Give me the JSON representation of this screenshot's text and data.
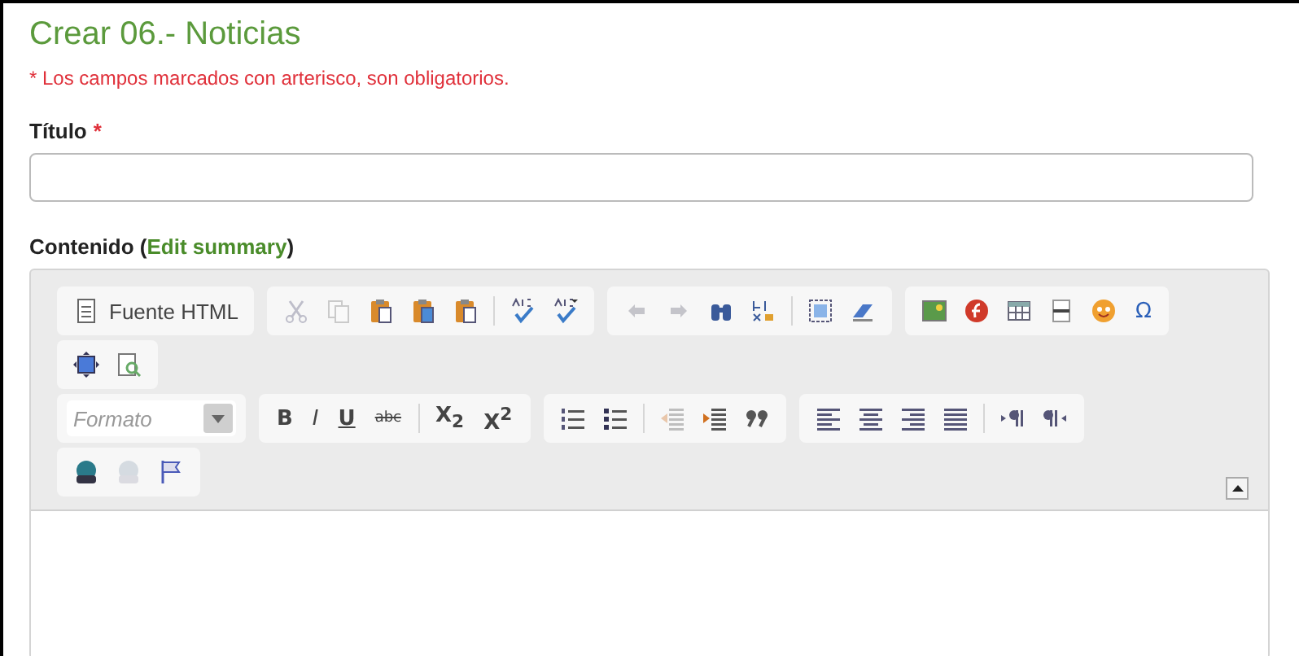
{
  "page": {
    "title": "Crear 06.- Noticias",
    "required_note": "* Los campos marcados con arterisco, son obligatorios."
  },
  "fields": [
    {
      "label": "Título",
      "required_mark": "*"
    }
  ],
  "content": {
    "label_prefix": "Contenido (",
    "link": "Edit summary",
    "label_suffix": ")"
  },
  "editor": {
    "toolbar_rows": [
      [
        [
          {
            "kind": "source",
            "label": "Fuente HTML"
          }
        ],
        [
          {
            "kind": "icon",
            "disabled": true
          },
          {
            "kind": "icon",
            "disabled": true
          },
          {
            "kind": "icon",
            "disabled": false
          },
          {
            "kind": "icon",
            "disabled": false
          },
          {
            "kind": "icon",
            "disabled": false
          },
          {
            "kind": "separator"
          },
          {
            "kind": "icon",
            "disabled": false
          },
          {
            "kind": "icon",
            "disabled": false
          }
        ],
        [
          {
            "kind": "icon",
            "disabled": true
          },
          {
            "kind": "icon",
            "disabled": true
          },
          {
            "kind": "icon",
            "disabled": false
          },
          {
            "kind": "icon",
            "disabled": false
          },
          {
            "kind": "separator"
          },
          {
            "kind": "icon",
            "disabled": false
          },
          {
            "kind": "icon",
            "disabled": false
          }
        ],
        [
          {
            "kind": "icon",
            "disabled": false
          },
          {
            "kind": "icon",
            "disabled": false
          },
          {
            "kind": "icon",
            "disabled": false
          },
          {
            "kind": "icon",
            "disabled": false
          },
          {
            "kind": "icon",
            "disabled": false
          },
          {
            "kind": "symbol",
            "label": "Ω"
          }
        ]
      ],
      [
        [
          {
            "kind": "icon",
            "disabled": false
          },
          {
            "kind": "icon",
            "disabled": false
          }
        ]
      ],
      [
        [
          {
            "kind": "combo",
            "placeholder": "Formato"
          }
        ],
        [
          {
            "kind": "bold",
            "label": "B"
          },
          {
            "kind": "italic",
            "label": "I"
          },
          {
            "kind": "underline",
            "label": "U"
          },
          {
            "kind": "strike",
            "label": "abc"
          },
          {
            "kind": "separator"
          },
          {
            "kind": "bold",
            "label": "X$_{2}$"
          },
          {
            "kind": "bold",
            "label": "X$^{2}$"
          }
        ],
        [
          {
            "kind": "icon",
            "disabled": false
          },
          {
            "kind": "icon",
            "disabled": false
          },
          {
            "kind": "separator"
          },
          {
            "kind": "icon",
            "disabled": true
          },
          {
            "kind": "icon",
            "disabled": false
          },
          {
            "kind": "icon",
            "disabled": false
          }
        ],
        [
          {
            "kind": "icon",
            "disabled": false
          },
          {
            "kind": "icon",
            "disabled": false
          },
          {
            "kind": "icon",
            "disabled": false
          },
          {
            "kind": "icon",
            "disabled": false
          },
          {
            "kind": "separator"
          },
          {
            "kind": "icon",
            "disabled": false
          },
          {
            "kind": "icon",
            "disabled": false
          }
        ]
      ],
      [
        [
          {
            "kind": "icon",
            "disabled": false
          },
          {
            "kind": "icon",
            "disabled": true
          },
          {
            "kind": "icon",
            "disabled": false
          }
        ]
      ]
    ]
  }
}
